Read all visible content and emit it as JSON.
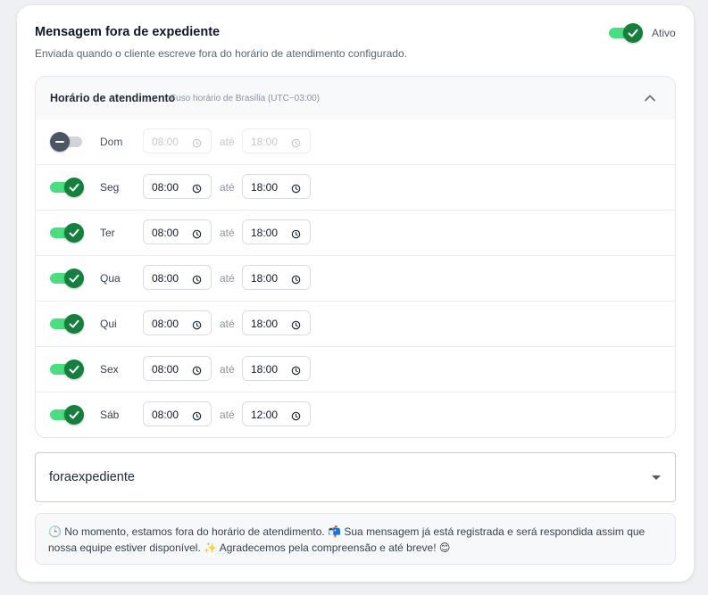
{
  "header": {
    "title": "Mensagem fora de expediente",
    "subtitle": "Enviada quando o cliente escreve fora do horário de atendimento configurado.",
    "status_label": "Ativo",
    "enabled": true
  },
  "schedule": {
    "title": "Horário de atendimento",
    "timezone": "Fuso horário de Brasília (UTC−03:00)",
    "separator": "até",
    "days": [
      {
        "label": "Dom",
        "enabled": false,
        "start": "08:00",
        "end": "18:00"
      },
      {
        "label": "Seg",
        "enabled": true,
        "start": "08:00",
        "end": "18:00"
      },
      {
        "label": "Ter",
        "enabled": true,
        "start": "08:00",
        "end": "18:00"
      },
      {
        "label": "Qua",
        "enabled": true,
        "start": "08:00",
        "end": "18:00"
      },
      {
        "label": "Qui",
        "enabled": true,
        "start": "08:00",
        "end": "18:00"
      },
      {
        "label": "Sex",
        "enabled": true,
        "start": "08:00",
        "end": "18:00"
      },
      {
        "label": "Sáb",
        "enabled": true,
        "start": "08:00",
        "end": "12:00"
      }
    ]
  },
  "template_select": {
    "value": "foraexpediente"
  },
  "message_preview": {
    "text": "🕒 No momento, estamos fora do horário de atendimento. 📬 Sua mensagem já está registrada e será respondida assim que nossa equipe estiver disponível. ✨ Agradecemos pela compreensão e até breve! 😊"
  },
  "colors": {
    "toggle_track_on": "#4ade80",
    "toggle_knob_on": "#15803d",
    "toggle_knob_off": "#4b5563"
  }
}
